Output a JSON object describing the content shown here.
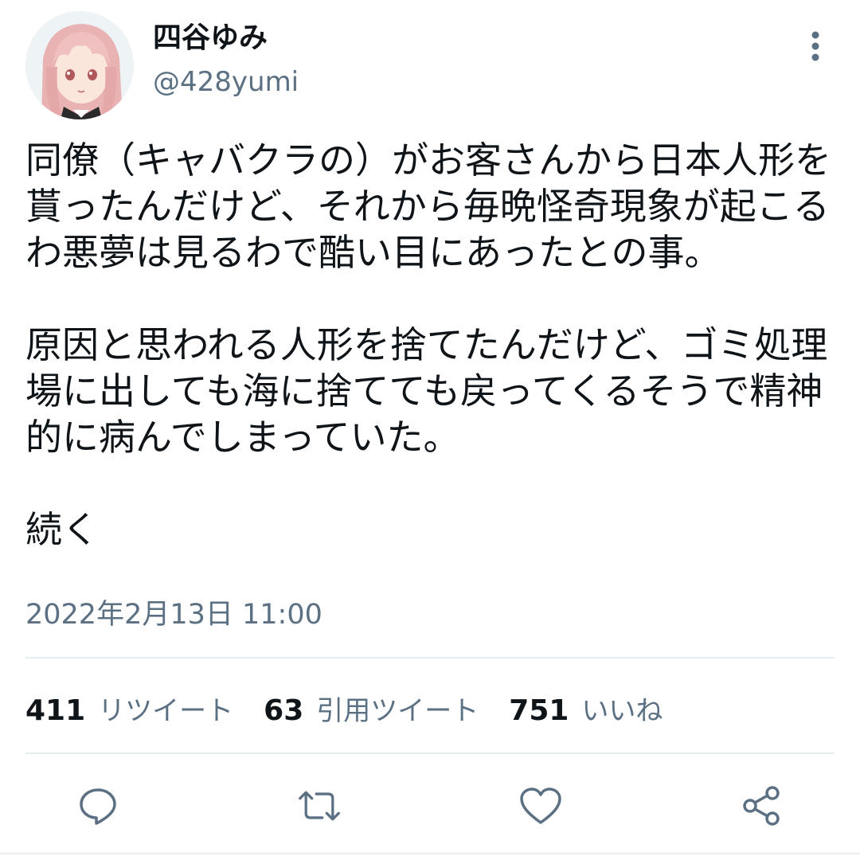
{
  "tweet": {
    "author": {
      "display_name": "四谷ゆみ",
      "handle": "@428yumi"
    },
    "paragraphs": [
      "同僚（キャバクラの）がお客さんから日本人形を貰ったんだけど、それから毎晩怪奇現象が起こるわ悪夢は見るわで酷い目にあったとの事。",
      "原因と思われる人形を捨てたんだけど、ゴミ処理場に出しても海に捨てても戻ってくるそうで精神的に病んでしまっていた。",
      "続く"
    ],
    "timestamp": "2022年2月13日 11:00",
    "stats": [
      {
        "count": "411",
        "label": "リツイート"
      },
      {
        "count": "63",
        "label": "引用ツイート"
      },
      {
        "count": "751",
        "label": "いいね"
      }
    ]
  },
  "icons": {
    "more": "more-vertical-icon",
    "reply": "reply-icon",
    "retweet": "retweet-icon",
    "like": "heart-icon",
    "share": "share-icon"
  },
  "colors": {
    "text_primary": "#0f1419",
    "text_secondary": "#5b7083",
    "divider": "#e6ecf0",
    "icon": "#5b7083"
  }
}
